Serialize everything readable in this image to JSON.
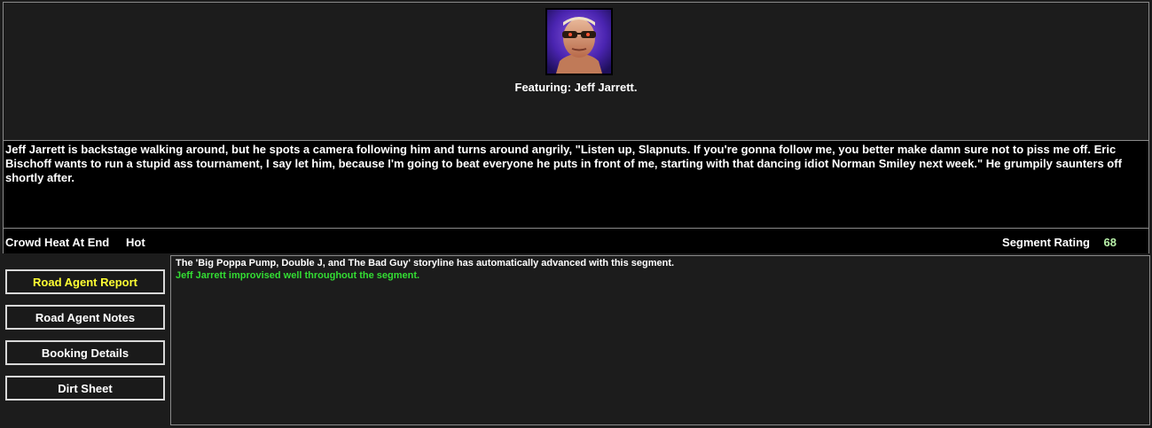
{
  "segment": {
    "featuring": "Featuring: Jeff Jarrett.",
    "portrait_alt": "Jeff Jarrett",
    "story": "Jeff Jarrett is backstage walking around, but he spots a camera following him and turns around angrily, \"Listen up, Slapnuts. If you're gonna follow me, you better make damn sure not to piss me off. Eric Bischoff wants to run a stupid ass tournament, I say let him, because I'm going to beat everyone he puts in front of me, starting with that dancing idiot Norman Smiley next week.\" He grumpily saunters off shortly after.",
    "crowd_heat_label": "Crowd Heat At End",
    "crowd_heat_value": "Hot",
    "rating_label": "Segment Rating",
    "rating_value": "68"
  },
  "buttons": [
    {
      "label": "Road Agent Report",
      "active": true
    },
    {
      "label": "Road Agent Notes",
      "active": false
    },
    {
      "label": "Booking Details",
      "active": false
    },
    {
      "label": "Dirt Sheet",
      "active": false
    }
  ],
  "report": [
    {
      "text": "The 'Big Poppa Pump, Double J, and The Bad Guy' storyline has automatically advanced with this segment.",
      "color": "#ffffff"
    },
    {
      "text": "Jeff Jarrett improvised well throughout the segment.",
      "color": "#33dd33"
    }
  ]
}
